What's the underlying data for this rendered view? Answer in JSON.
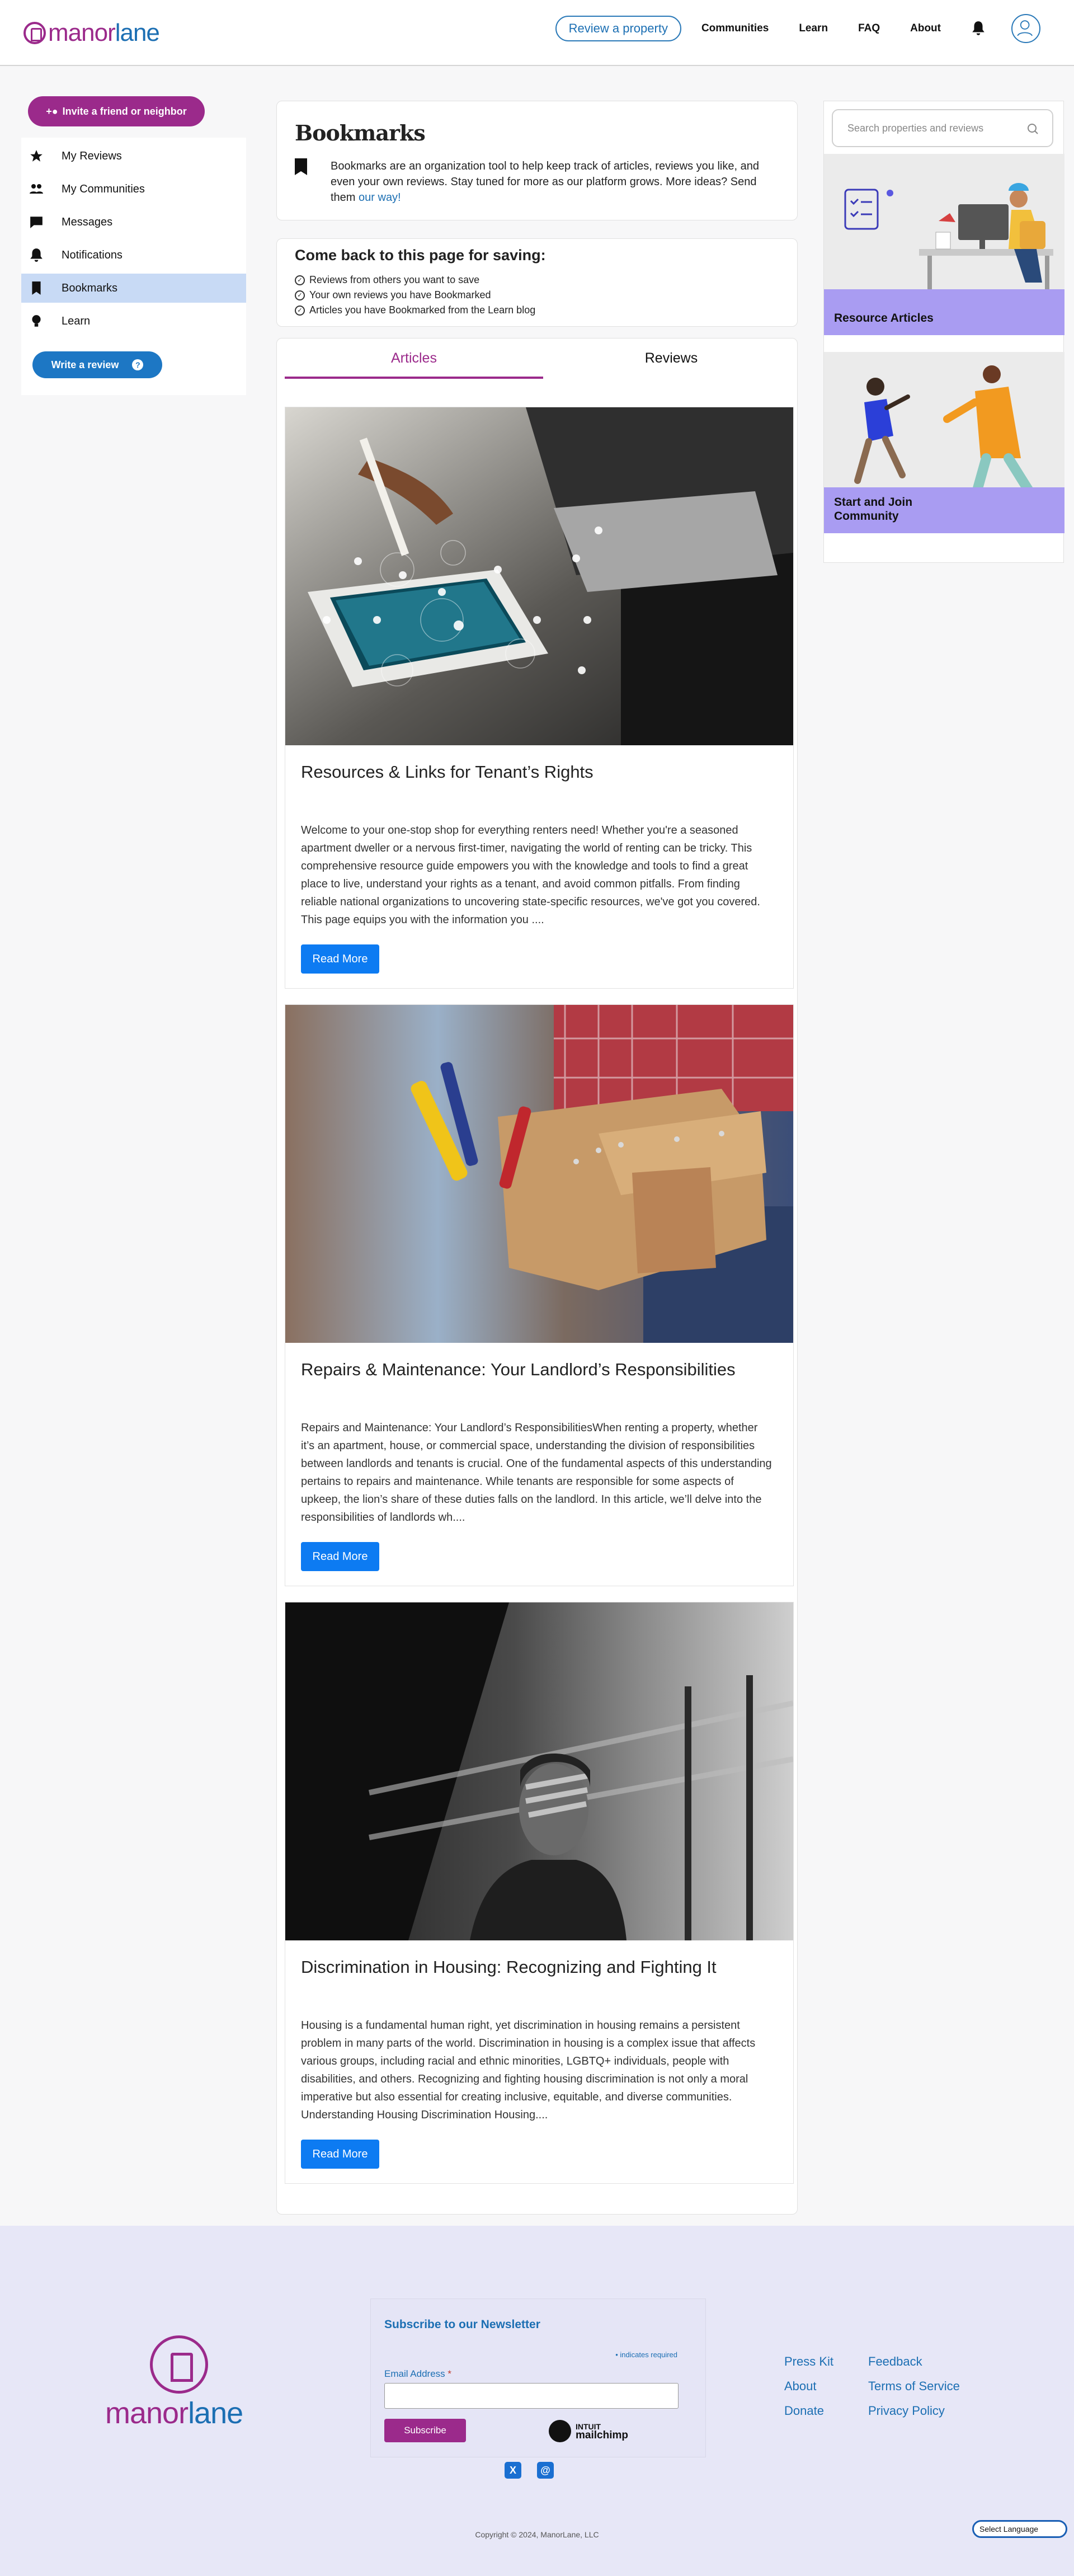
{
  "header": {
    "brand_part1": "manor",
    "brand_part2": "lane",
    "review_button": "Review a property",
    "nav": [
      "Communities",
      "Learn",
      "FAQ",
      "About"
    ]
  },
  "sidebar": {
    "invite_label": "Invite a friend or neighbor",
    "items": [
      {
        "label": "My Reviews",
        "icon": "star-icon"
      },
      {
        "label": "My Communities",
        "icon": "users-icon"
      },
      {
        "label": "Messages",
        "icon": "chat-icon"
      },
      {
        "label": "Notifications",
        "icon": "bell-icon"
      },
      {
        "label": "Bookmarks",
        "icon": "bookmark-icon",
        "active": true
      },
      {
        "label": "Learn",
        "icon": "lightbulb-icon"
      }
    ],
    "write_review": "Write a review",
    "write_review_help": "?"
  },
  "bookmarks": {
    "title": "Bookmarks",
    "description": "Bookmarks are an organization tool to help keep track of articles, reviews you like, and even your own reviews. Stay tuned for more as our platform grows. More ideas? Send them ",
    "link_text": "our way!"
  },
  "saving": {
    "title": "Come back to this page for saving:",
    "items": [
      "Reviews from others you want to save",
      "Your own reviews you have Bookmarked",
      "Articles you have Bookmarked from the Learn blog"
    ]
  },
  "tabs": {
    "articles": "Articles",
    "reviews": "Reviews",
    "active": "Articles"
  },
  "articles": [
    {
      "title": "Resources & Links for Tenant’s Rights",
      "excerpt": "Welcome to your one-stop shop for everything renters need! Whether you're a seasoned apartment dweller or a nervous first-timer, navigating the world of renting can be tricky. This comprehensive resource guide empowers you with the knowledge and tools to find a great place to live, understand your rights as a tenant, and avoid common pitfalls. From finding reliable national organizations to uncovering state-specific resources, we've got you covered. This page equips you with the information you ....",
      "button": "Read More"
    },
    {
      "title": "Repairs & Maintenance: Your Landlord’s Responsibilities",
      "excerpt": "Repairs and Maintenance: Your Landlord’s ResponsibilitiesWhen renting a property, whether it’s an apartment, house, or commercial space, understanding the division of responsibilities between landlords and tenants is crucial. One of the fundamental aspects of this understanding pertains to repairs and maintenance. While tenants are responsible for some aspects of upkeep, the lion’s share of these duties falls on the landlord. In this article, we’ll delve into the responsibilities of landlords wh....",
      "button": "Read More"
    },
    {
      "title": "Discrimination in Housing: Recognizing and Fighting It",
      "excerpt": "Housing is a fundamental human right, yet discrimination in housing remains a persistent problem in many parts of the world. Discrimination in housing is a complex issue that affects various groups, including racial and ethnic minorities, LGBTQ+ individuals, people with disabilities, and others. Recognizing and fighting housing discrimination is not only a moral imperative but also essential for creating inclusive, equitable, and diverse communities. Understanding Housing Discrimination Housing....",
      "button": "Read More"
    }
  ],
  "right": {
    "search_placeholder": "Search properties and reviews",
    "promo1": "Resource Articles",
    "promo2_line1": "Start and Join",
    "promo2_line2": "Community"
  },
  "footer": {
    "brand_part1": "manor",
    "brand_part2": "lane",
    "newsletter_title": "Subscribe to our Newsletter",
    "required_note": "• indicates required",
    "email_label": "Email Address",
    "required_star": "*",
    "subscribe": "Subscribe",
    "mailchimp_top": "INTUIT",
    "mailchimp_bottom": "mailchimp",
    "links_col1": [
      "Press Kit",
      "About",
      "Donate"
    ],
    "links_col2": [
      "Feedback",
      "Terms of Service",
      "Privacy Policy"
    ],
    "social_x": "X",
    "social_threads": "@",
    "copyright": "Copyright © 2024, ManorLane, LLC",
    "language": "Select Language"
  },
  "colors": {
    "brand_purple": "#9b2a8b",
    "brand_blue": "#1c6fb3",
    "button_blue": "#0d7bf2",
    "active_nav": "#c8daf5",
    "promo_band": "#a99cf2"
  }
}
